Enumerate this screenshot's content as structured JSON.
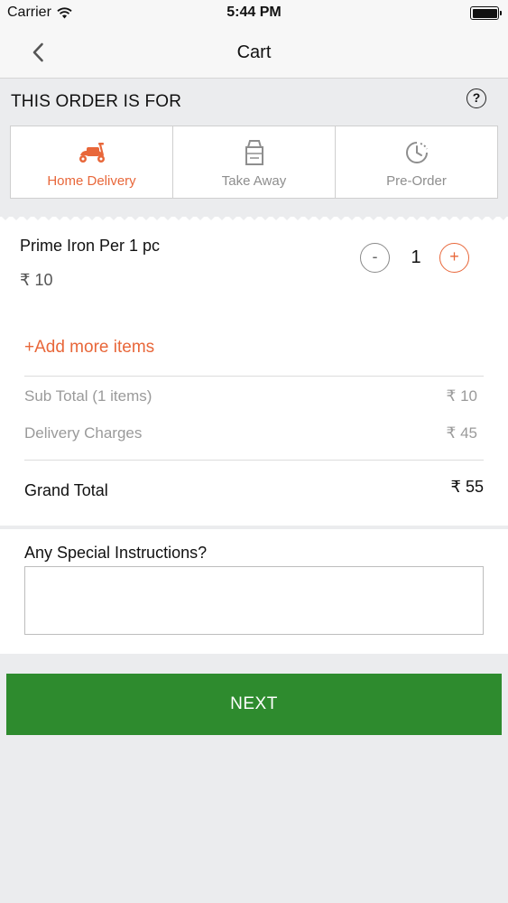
{
  "status_bar": {
    "carrier": "Carrier",
    "time": "5:44 PM"
  },
  "nav": {
    "title": "Cart"
  },
  "order_for": {
    "heading": "THIS ORDER IS FOR",
    "help_icon": "question-circle-icon",
    "options": [
      {
        "label": "Home Delivery",
        "icon": "scooter-icon",
        "active": true
      },
      {
        "label": "Take Away",
        "icon": "takeaway-bag-icon",
        "active": false
      },
      {
        "label": "Pre-Order",
        "icon": "clock-icon",
        "active": false
      }
    ]
  },
  "cart": {
    "item": {
      "name": "Prime Iron Per 1 pc",
      "price": "₹ 10",
      "quantity": "1",
      "minus_label": "-",
      "plus_label": "+"
    },
    "add_more_label": "+Add more items",
    "sub_total_label": "Sub Total (1 items)",
    "sub_total_value": "₹ 10",
    "delivery_label": "Delivery Charges",
    "delivery_value": "₹ 45",
    "grand_total_label": "Grand Total",
    "grand_total_value": "₹ 55"
  },
  "instructions": {
    "label": "Any Special Instructions?",
    "value": "",
    "placeholder": ""
  },
  "next_button": {
    "label": "NEXT"
  },
  "colors": {
    "accent": "#e8673a",
    "next_button": "#2e8b2e",
    "background": "#ebecee"
  }
}
